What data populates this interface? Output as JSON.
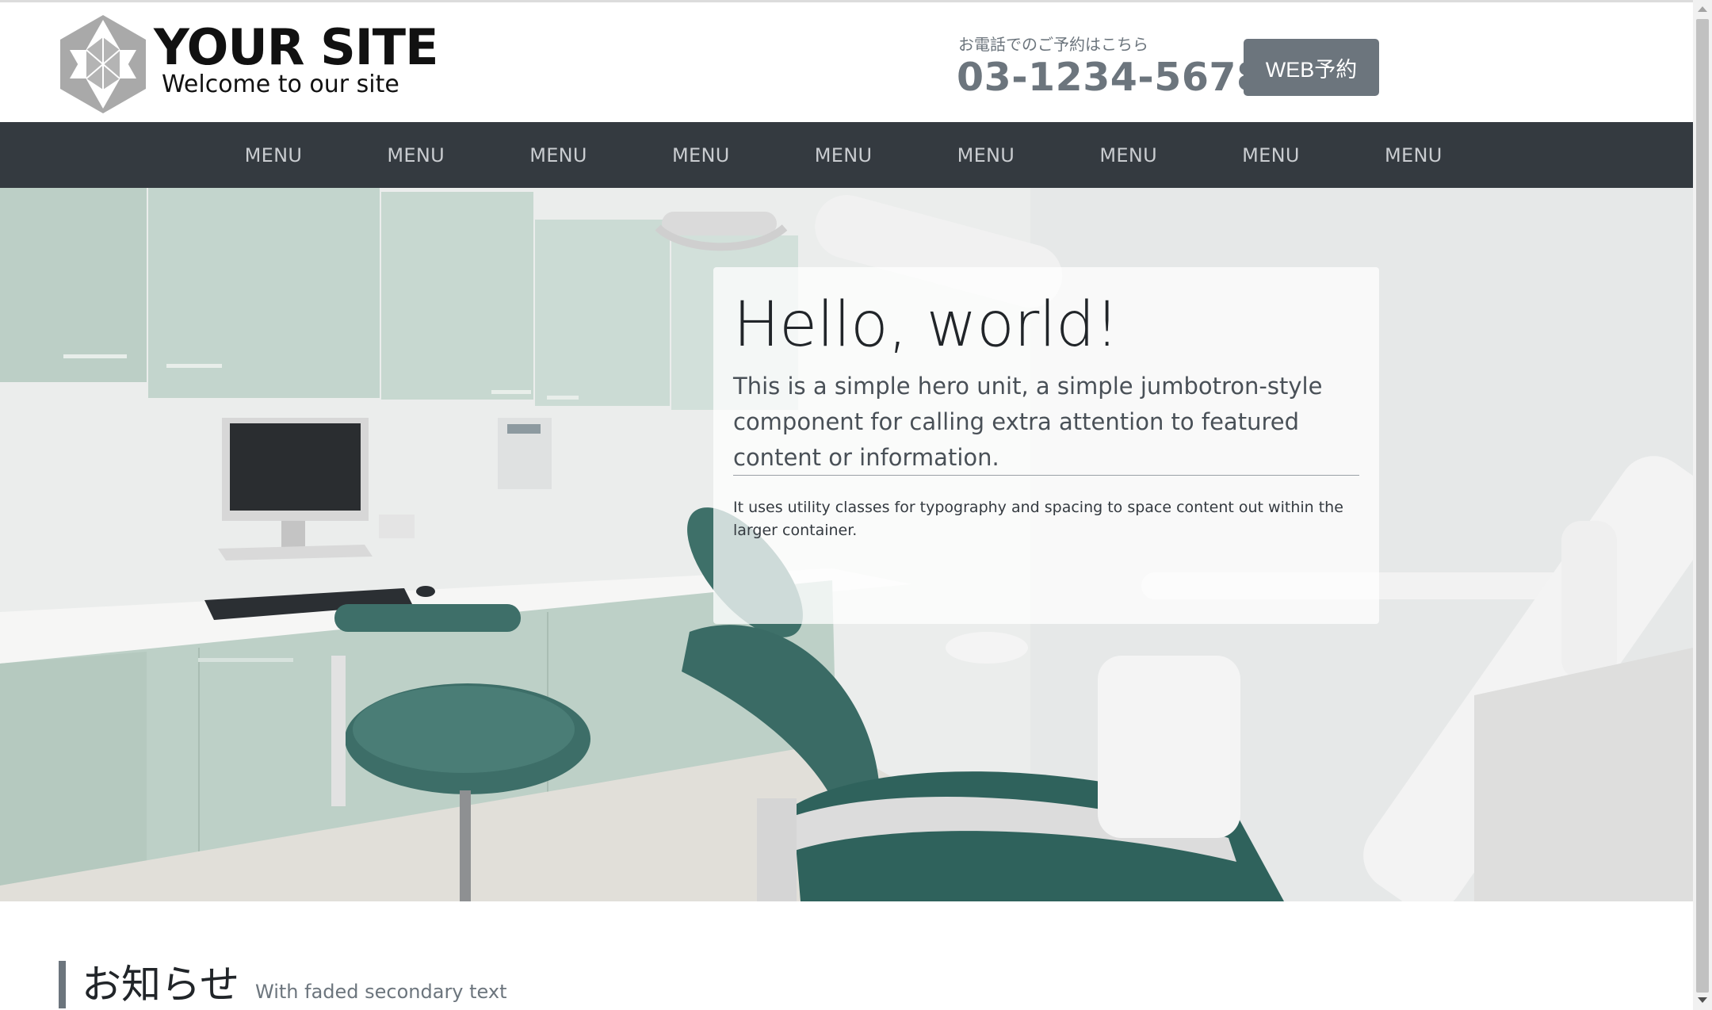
{
  "header": {
    "logo_title": "YOUR SITE",
    "logo_subtitle": "Welcome to our site",
    "tel_label": "お電話でのご予約はこちら",
    "tel_number": "03-1234-5678",
    "web_button": "WEB予約",
    "accent_color": "#6c757d"
  },
  "nav": {
    "background": "#343a40",
    "items": [
      "MENU",
      "MENU",
      "MENU",
      "MENU",
      "MENU",
      "MENU",
      "MENU",
      "MENU",
      "MENU"
    ]
  },
  "hero": {
    "title": "Hello, world!",
    "lead": "This is a simple hero unit, a simple jumbotron-style component for calling extra attention to featured content or information.",
    "text": "It uses utility classes for typography and spacing to space content out within the larger container."
  },
  "notice": {
    "title": "お知らせ",
    "subtitle": "With faded secondary text"
  },
  "icons": {
    "logo": "hexagram-logo-icon",
    "scroll_up": "scroll-up-arrow-icon",
    "scroll_down": "scroll-down-arrow-icon"
  }
}
